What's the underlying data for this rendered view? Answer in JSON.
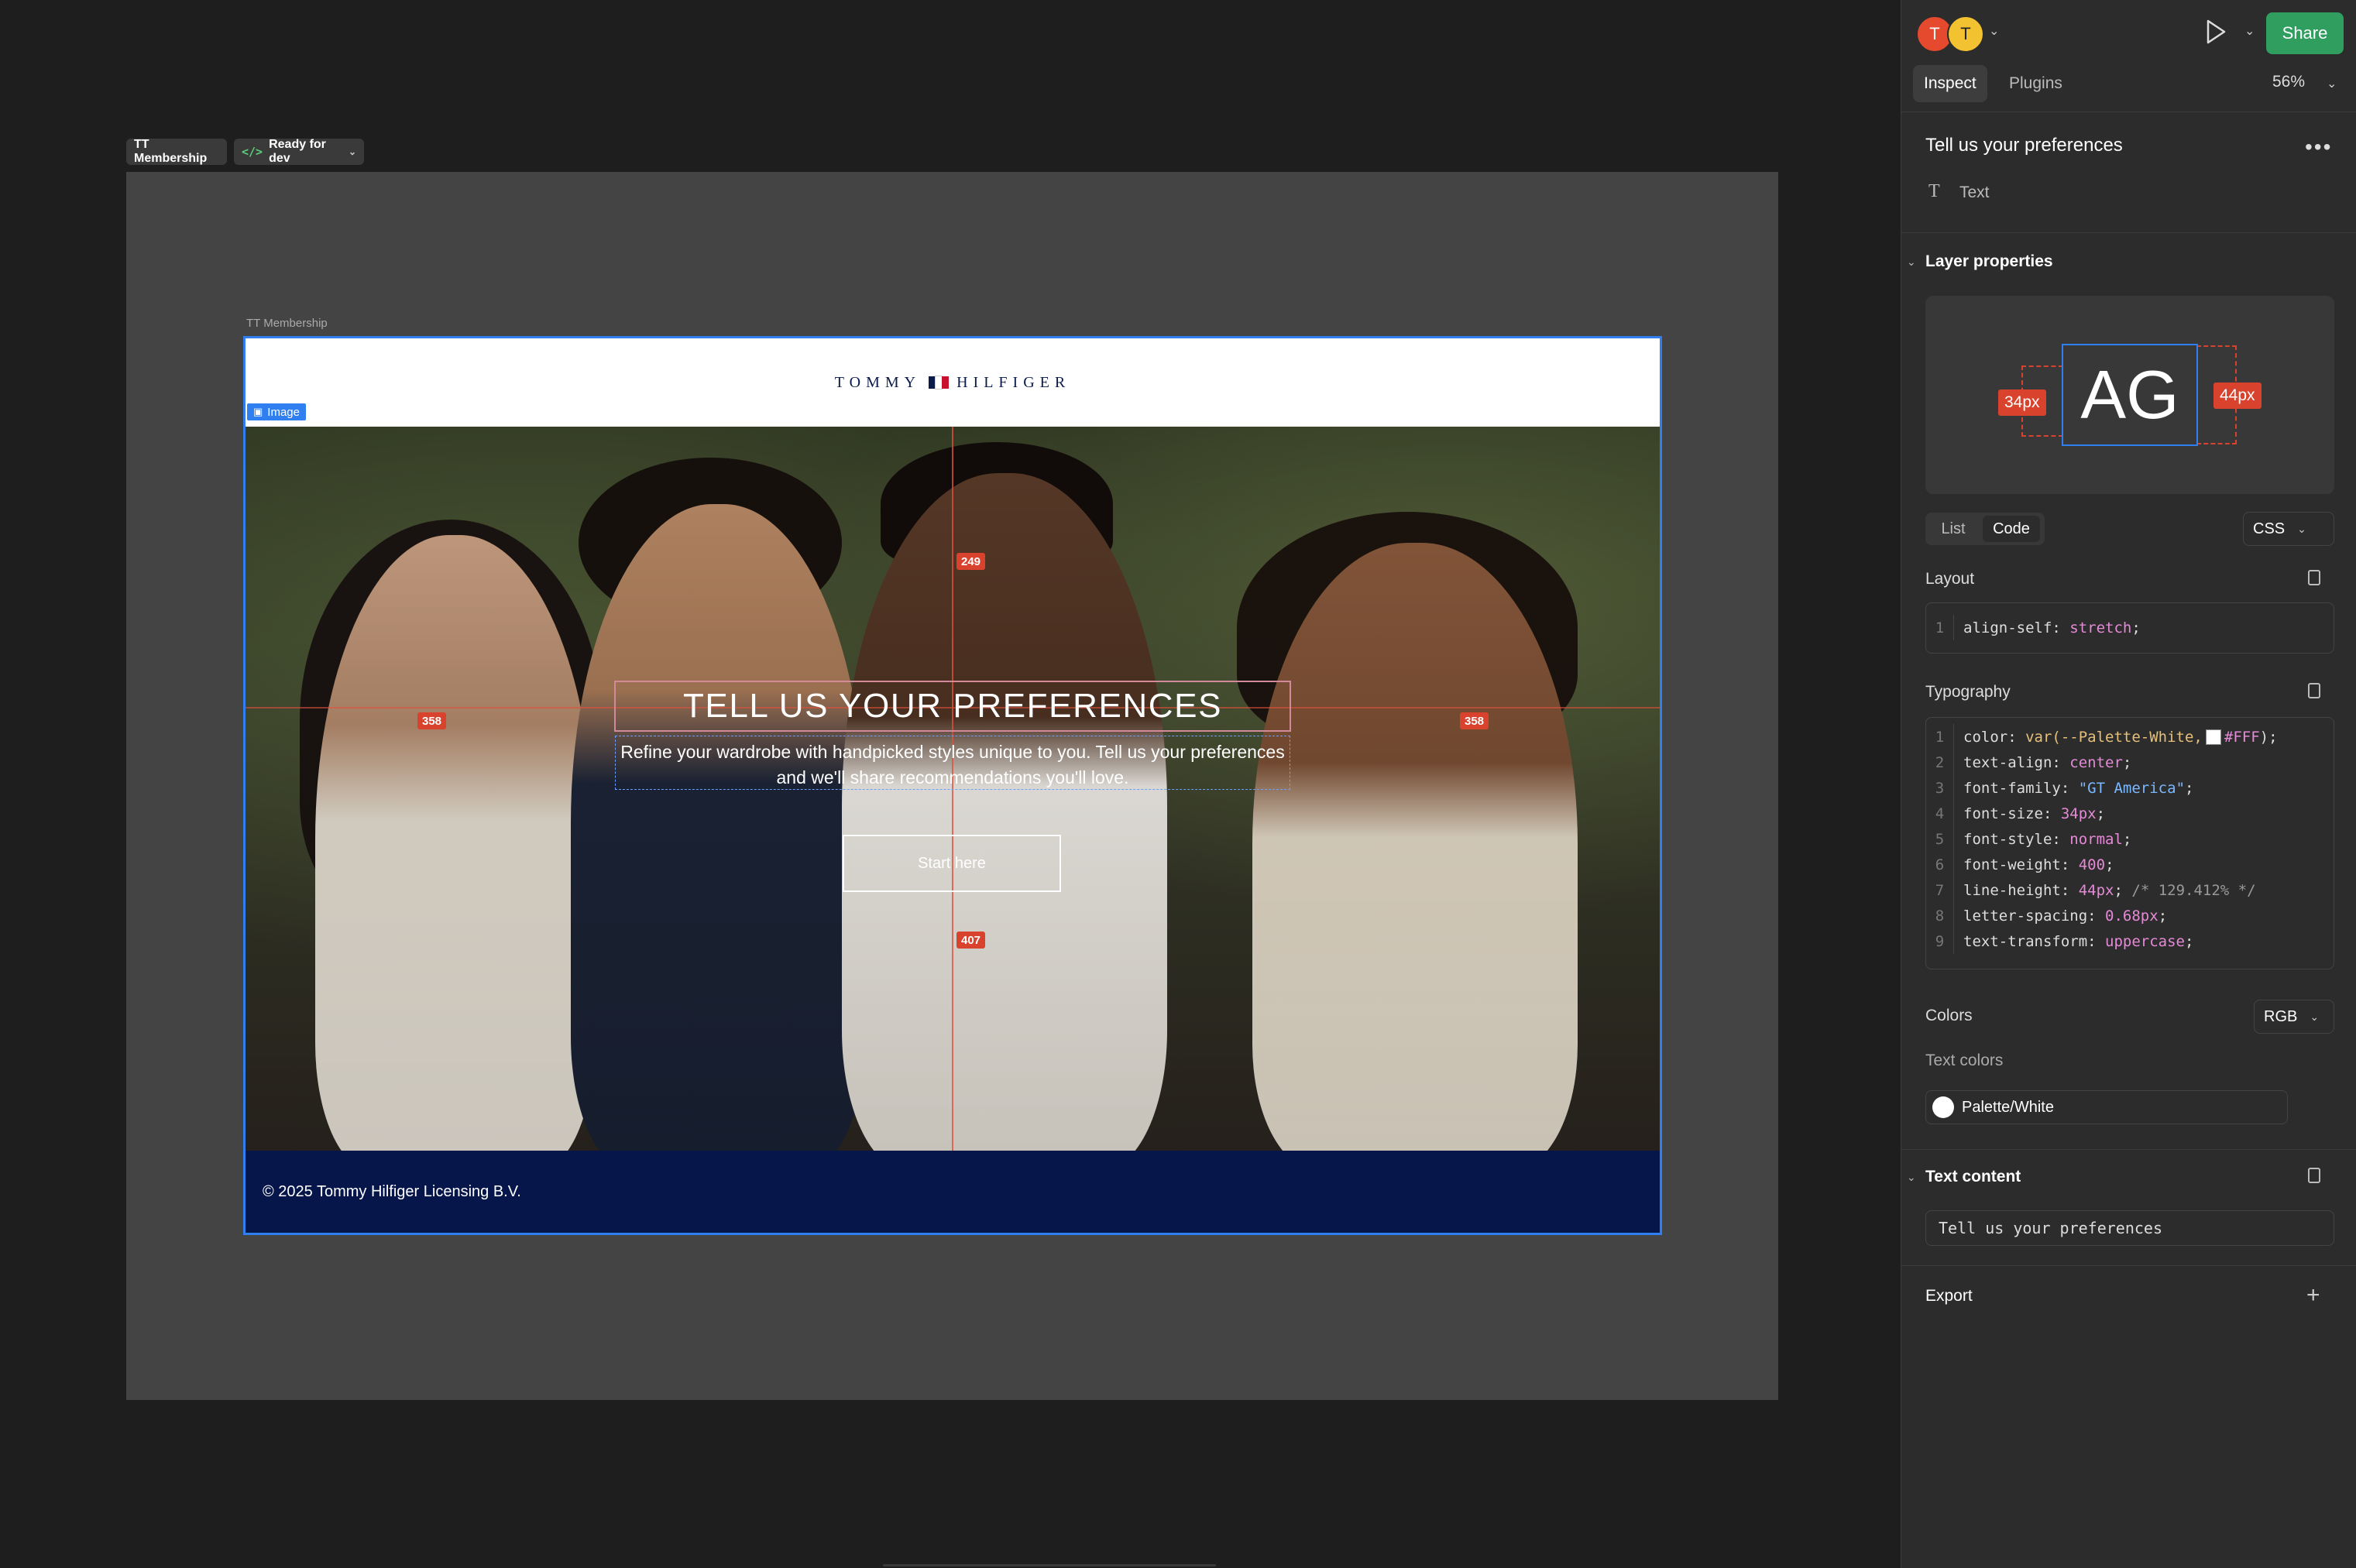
{
  "canvas": {
    "frame_chip_name": "TT Membership",
    "frame_chip_status": "Ready for dev",
    "frame_label": "TT Membership",
    "image_tag": "Image",
    "brand": {
      "left": "TOMMY",
      "right": "HILFIGER"
    },
    "hero_title": "Tell us your preferences",
    "hero_sub": "Refine your wardrobe with handpicked styles unique to you. Tell us your preferences and we'll share recommendations you'll love.",
    "cta": "Start here",
    "footer": "© 2025 Tommy Hilfiger Licensing B.V.",
    "measures": {
      "top": "249",
      "left": "358",
      "right": "358",
      "bottom": "407"
    }
  },
  "panel": {
    "avatars": [
      "T",
      "T"
    ],
    "share": "Share",
    "tabs": [
      "Inspect",
      "Plugins"
    ],
    "zoom": "56%",
    "layer_title": "Tell us your preferences",
    "layer_type": "Text",
    "layer_properties": "Layer properties",
    "preview": {
      "glyphs": "AG",
      "left_badge": "34px",
      "right_badge": "44px"
    },
    "view_toggle": [
      "List",
      "Code"
    ],
    "lang": "CSS",
    "layout_label": "Layout",
    "typography_label": "Typography",
    "colors_label": "Colors",
    "color_mode": "RGB",
    "text_colors_label": "Text colors",
    "text_color_name": "Palette/White",
    "text_content_label": "Text content",
    "text_content": "Tell us your preferences",
    "export_label": "Export",
    "layout_code": [
      {
        "n": "1",
        "prop": "align-self",
        "val": "stretch"
      }
    ],
    "typography_code": [
      {
        "n": "1",
        "prop": "color",
        "fn": "var(--Palette-White,",
        "val": "#FFF",
        "end": ");"
      },
      {
        "n": "2",
        "prop": "text-align",
        "val": "center"
      },
      {
        "n": "3",
        "prop": "font-family",
        "str": "\"GT America\""
      },
      {
        "n": "4",
        "prop": "font-size",
        "val": "34px"
      },
      {
        "n": "5",
        "prop": "font-style",
        "val": "normal"
      },
      {
        "n": "6",
        "prop": "font-weight",
        "val": "400"
      },
      {
        "n": "7",
        "prop": "line-height",
        "val": "44px",
        "cmt": "/* 129.412% */"
      },
      {
        "n": "8",
        "prop": "letter-spacing",
        "val": "0.68px"
      },
      {
        "n": "9",
        "prop": "text-transform",
        "val": "uppercase"
      }
    ],
    "colors": {
      "brand_navy": "#06154A",
      "share_green": "#2F9E5F",
      "guide_red": "#D9432E",
      "selection_blue": "#2F7FF0"
    }
  }
}
